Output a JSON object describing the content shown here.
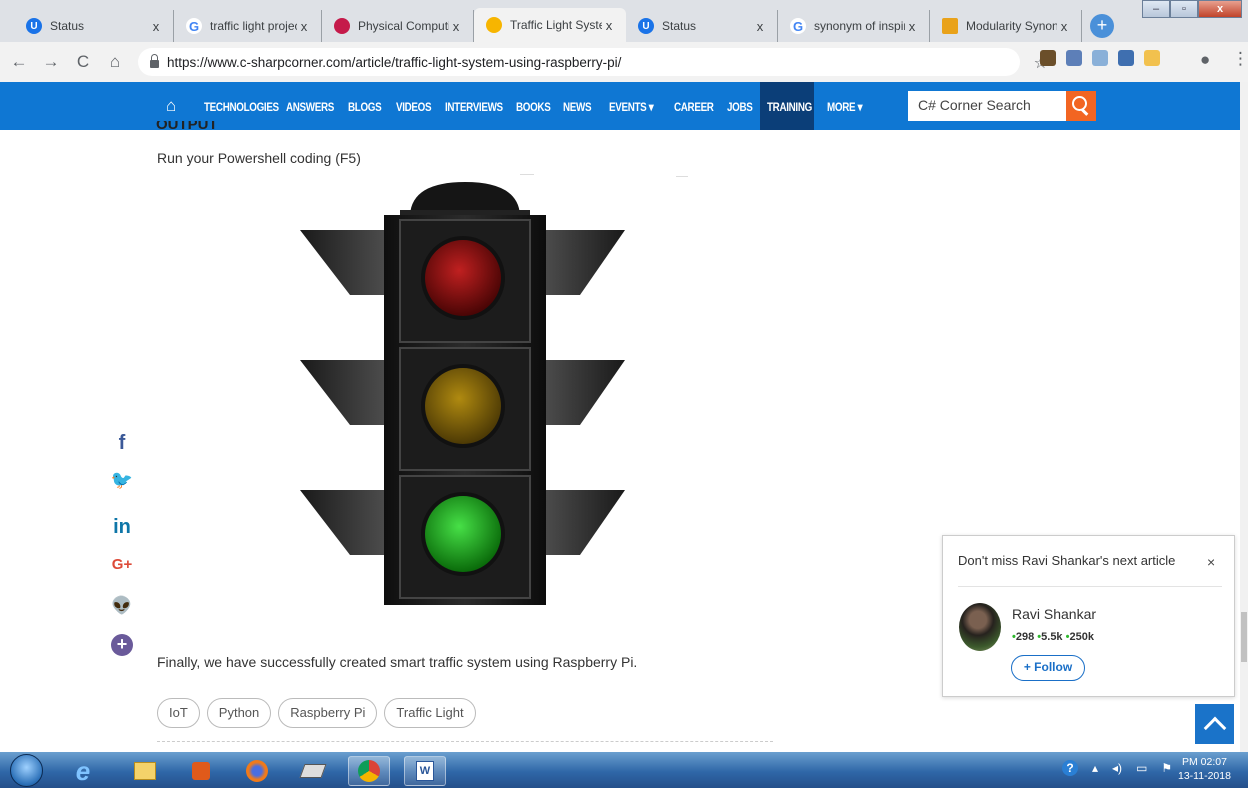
{
  "browser": {
    "tabs": [
      {
        "title": "Status",
        "favicon": "status-favicon"
      },
      {
        "title": "traffic light project",
        "favicon": "google-favicon"
      },
      {
        "title": "Physical Computing",
        "favicon": "raspberry-pi-favicon"
      },
      {
        "title": "Traffic Light System",
        "favicon": "csharpcorner-favicon",
        "active": true
      },
      {
        "title": "Status",
        "favicon": "status-favicon"
      },
      {
        "title": "synonym of inspire",
        "favicon": "google-favicon"
      },
      {
        "title": "Modularity Synonym",
        "favicon": "thesaurus-favicon"
      }
    ],
    "close_glyph": "x",
    "new_tab_glyph": "+",
    "window_controls": {
      "minimize": "–",
      "maximize": "▫",
      "close": "x"
    },
    "url": "https://www.c-sharpcorner.com/article/traffic-light-system-using-raspberry-pi/"
  },
  "site_nav": {
    "items": [
      "TECHNOLOGIES",
      "ANSWERS",
      "BLOGS",
      "VIDEOS",
      "INTERVIEWS",
      "BOOKS",
      "NEWS",
      "EVENTS ▾",
      "CAREER",
      "JOBS",
      "TRAINING",
      "MORE ▾"
    ],
    "search_placeholder": "C# Corner Search",
    "accent_color": "#0f77d3",
    "active_item_color": "#0b3e78",
    "search_button_color": "#f26522"
  },
  "article": {
    "cut_heading": "OUTPUT",
    "run_instruction": "Run your Powershell coding (F5)",
    "conclusion": "Finally, we have successfully created smart traffic system using Raspberry Pi.",
    "tags": [
      "IoT",
      "Python",
      "Raspberry Pi",
      "Traffic Light"
    ],
    "image": {
      "lights": [
        "red",
        "amber",
        "green"
      ],
      "lit": "green"
    }
  },
  "share_icons": [
    {
      "glyph": "f",
      "name": "facebook-icon",
      "color": "#3b5998"
    },
    {
      "glyph": "🐦",
      "name": "twitter-icon",
      "color": "#1da1f2"
    },
    {
      "glyph": "in",
      "name": "linkedin-icon",
      "color": "#0e76a8"
    },
    {
      "glyph": "G+",
      "name": "google-plus-icon",
      "color": "#dd4b39"
    },
    {
      "glyph": "👽",
      "name": "reddit-icon",
      "color": "#ff4500"
    },
    {
      "glyph": "+",
      "name": "more-share-icon",
      "color": "#6a5a9a"
    }
  ],
  "follow_popup": {
    "title": "Don't miss Ravi Shankar's next article",
    "close": "×",
    "author": "Ravi Shankar",
    "stats": [
      "298",
      "5.5k",
      "250k"
    ],
    "follow_label": "+ Follow"
  },
  "taskbar": {
    "apps": [
      "start-orb",
      "internet-explorer-icon",
      "file-explorer-icon",
      "media-player-icon",
      "firefox-icon",
      "scanner-icon",
      "chrome-icon",
      "word-icon"
    ],
    "time": "PM 02:07",
    "date": "13-11-2018"
  }
}
